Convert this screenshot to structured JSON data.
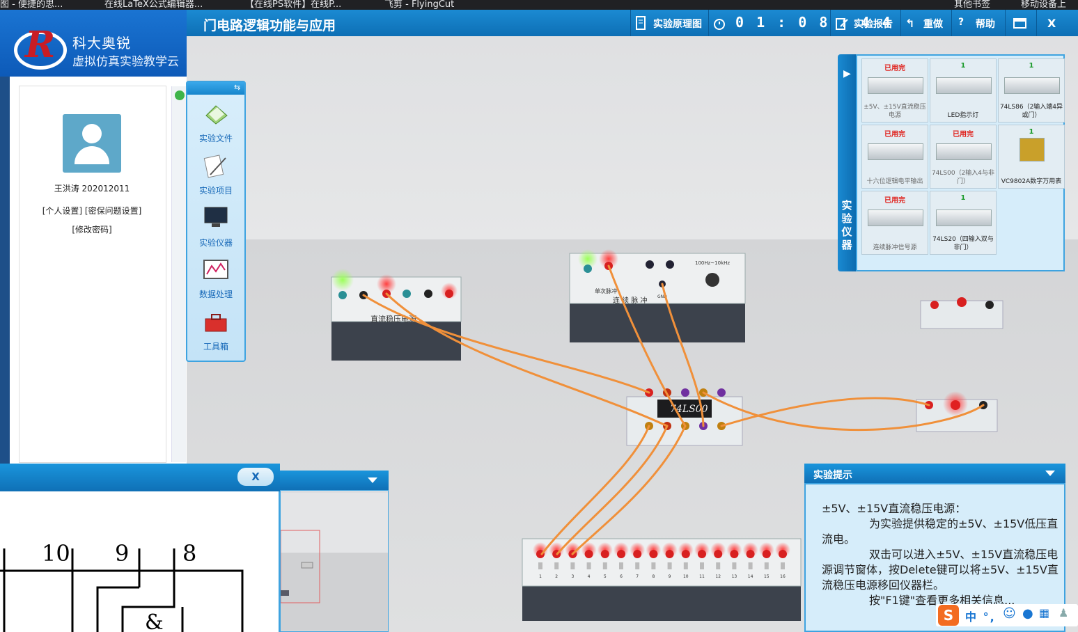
{
  "bookmarks": [
    "图 - 便捷的思...",
    "在线LaTeX公式编辑器...",
    "【在线PS软件】在线P...",
    "飞剪 - FlyingCut",
    "其他书签",
    "移动设备上"
  ],
  "portal": {
    "logo_line1": "科大奥锐",
    "logo_line2": "虚拟仿真实验教学云",
    "user_name": "王洪涛 202012011",
    "link_personal": "[个人设置]",
    "link_security": "[密保问题设置]",
    "link_password": "[修改密码]"
  },
  "window": {
    "title": "门电路逻辑功能与应用",
    "btn_schematic": "实验原理图",
    "timer": "0 1 : 0 8 : 4 4",
    "btn_report": "实验报告",
    "btn_redo": "重做",
    "btn_help": "帮助",
    "btn_close": "X"
  },
  "tools": [
    "实验文件",
    "实验项目",
    "实验仪器",
    "数据处理",
    "工具箱"
  ],
  "dock": {
    "tab_label": "实验仪器",
    "items": [
      {
        "status": "已用完",
        "name": "±5V、±15V直流稳压电源"
      },
      {
        "status": "1",
        "name": "LED指示灯"
      },
      {
        "status": "1",
        "name": "74LS86（2输入端4异或门）"
      },
      {
        "status": "已用完",
        "name": "十六位逻辑电平输出"
      },
      {
        "status": "已用完",
        "name": "74LS00（2输入4与非门）"
      },
      {
        "status": "1",
        "name": "VC9802A数字万用表"
      },
      {
        "status": "已用完",
        "name": "连续脉冲信号源"
      },
      {
        "status": "1",
        "name": "74LS20（四输入双与非门）"
      }
    ]
  },
  "instruments": {
    "psu_label": "直流稳压电源",
    "pulse_label_left": "单次脉冲",
    "pulse_label_bottom": "连 续 脉 冲",
    "pulse_freq": "100Hz~10kHz",
    "pulse_gnd": "GND",
    "chip_label": "74LS00",
    "logic_numbers": [
      "1",
      "2",
      "3",
      "4",
      "5",
      "6",
      "7",
      "8",
      "9",
      "10",
      "11",
      "12",
      "13",
      "14",
      "15",
      "16"
    ]
  },
  "schematic": {
    "close_label": "X",
    "pins": [
      "10",
      "9",
      "8"
    ],
    "gate_symbol": "&"
  },
  "hint": {
    "title": "实验提示",
    "line1": "±5V、±15V直流稳压电源：",
    "line2": "为实验提供稳定的±5V、±15V低压直流电。",
    "line3": "双击可以进入±5V、±15V直流稳压电源调节窗体，按Delete键可以将±5V、±15V直流稳压电源移回仪器栏。",
    "line4": "按\"F1键\"查看更多相关信息..."
  },
  "ime": {
    "logo": "S",
    "text": "中 °,"
  },
  "colors": {
    "title_bar": "#1180c8",
    "panel_bg": "#d6edfa",
    "used_up": "#e0201b",
    "available": "#1a9a2a",
    "wire": "#f0903a"
  }
}
